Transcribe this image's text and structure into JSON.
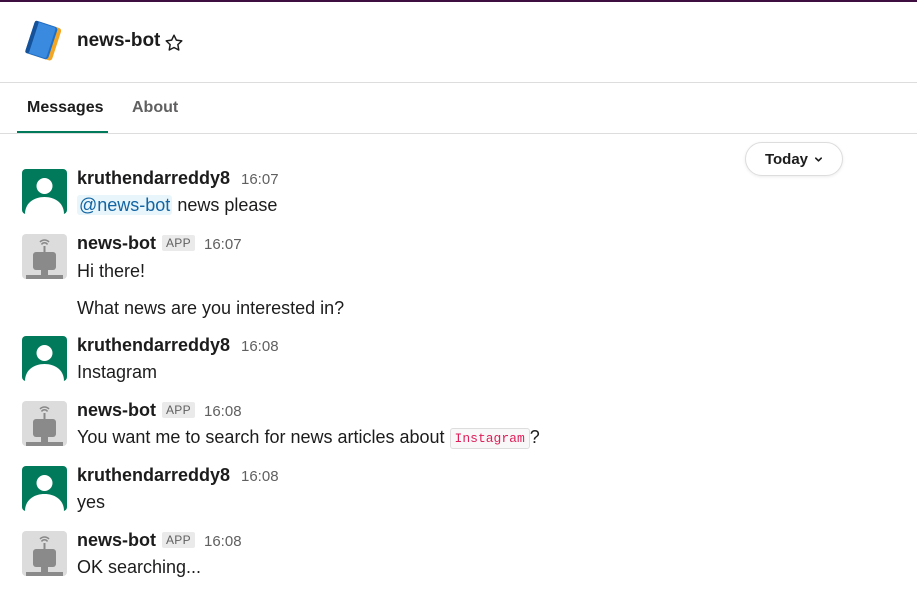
{
  "channel": {
    "title": "news-bot",
    "icon": "book-icon",
    "star_icon": "star-outline-icon"
  },
  "tabs": [
    {
      "label": "Messages",
      "active": true
    },
    {
      "label": "About",
      "active": false
    }
  ],
  "date_divider": {
    "label": "Today",
    "icon": "chevron-down-icon"
  },
  "badge_label": "APP",
  "colors": {
    "accent": "#007a5a",
    "mention": "#1264a3",
    "code": "#e01e5a",
    "topbar": "#3f0e40"
  },
  "messages": [
    {
      "author": "kruthendarreddy8",
      "time": "16:07",
      "mention": "@news-bot",
      "text": " news please"
    },
    {
      "author": "news-bot",
      "time": "16:07",
      "lines": [
        "Hi there!",
        "What news are you interested in?"
      ]
    },
    {
      "author": "kruthendarreddy8",
      "time": "16:08",
      "text": "Instagram"
    },
    {
      "author": "news-bot",
      "time": "16:08",
      "text_before": "You want me to search for news articles about ",
      "code": "Instagram",
      "text_after": "?"
    },
    {
      "author": "kruthendarreddy8",
      "time": "16:08",
      "text": "yes"
    },
    {
      "author": "news-bot",
      "time": "16:08",
      "text": "OK searching..."
    }
  ]
}
